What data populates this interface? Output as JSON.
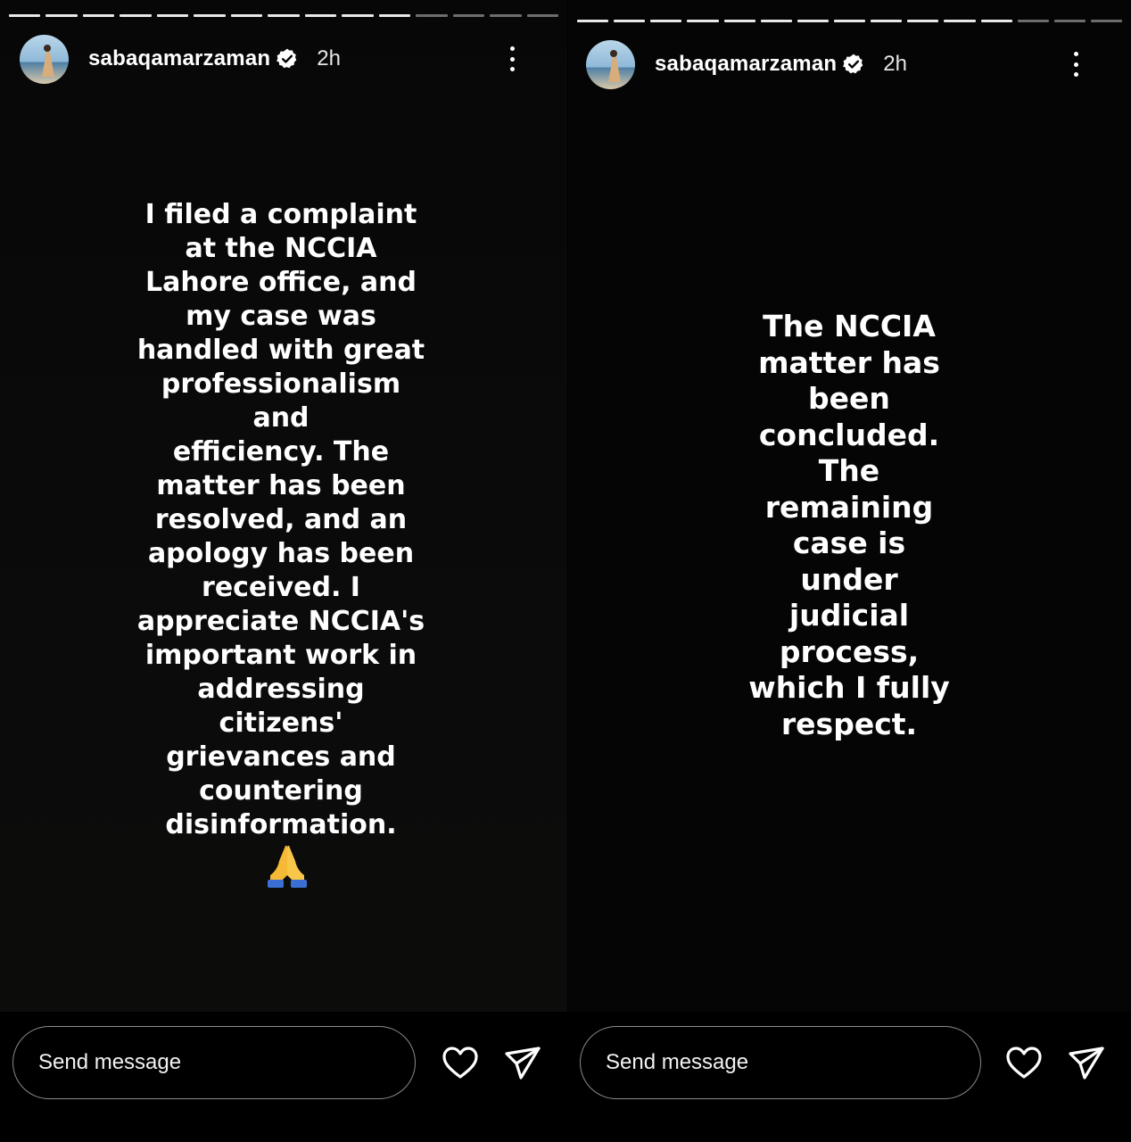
{
  "stories": [
    {
      "username": "sabaqamarzaman",
      "time": "2h",
      "text": "I filed a complaint\nat the NCCIA\nLahore office, and\nmy case was\nhandled with great\nprofessionalism and\nefficiency. The\nmatter has been\nresolved, and an\napology has been\nreceived. I\nappreciate NCCIA's\nimportant work in\naddressing citizens'\ngrievances and\ncountering\ndisinformation.",
      "emoji": "folded-hands",
      "send_placeholder": "Send message"
    },
    {
      "username": "sabaqamarzaman",
      "time": "2h",
      "text": "The NCCIA\nmatter has\nbeen\nconcluded.\nThe\nremaining\ncase is\nunder\njudicial\nprocess,\nwhich I fully\nrespect.",
      "send_placeholder": "Send message"
    }
  ],
  "icons": [
    "verified-badge-icon",
    "more-options-icon",
    "heart-icon",
    "share-icon"
  ]
}
